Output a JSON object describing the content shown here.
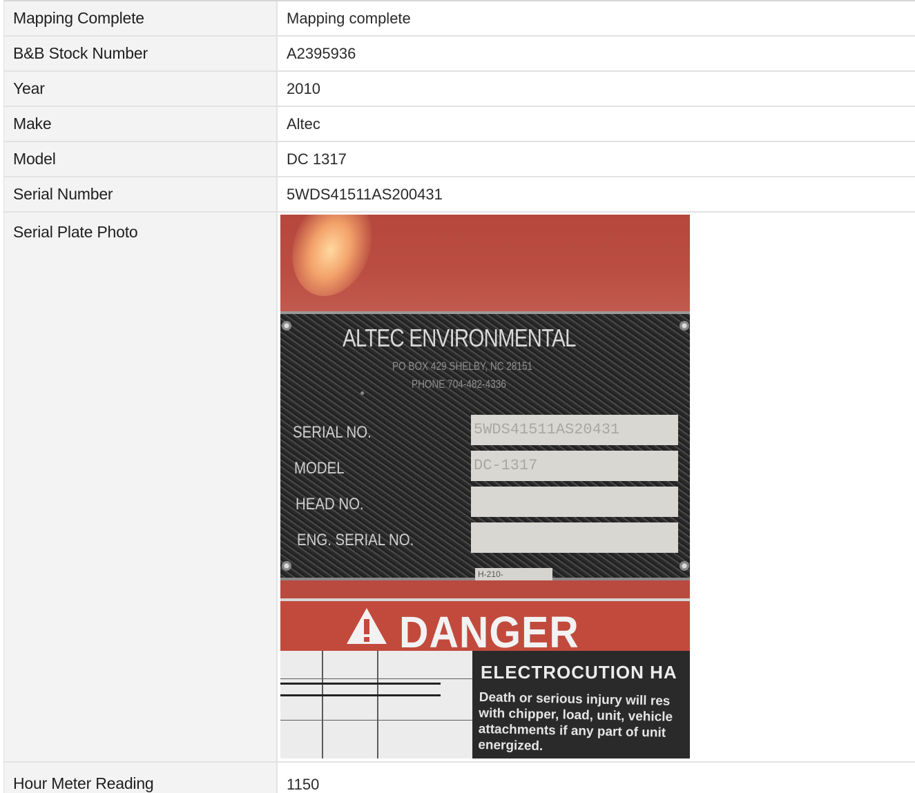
{
  "rows": [
    {
      "label": "Mapping Complete",
      "value": "Mapping complete"
    },
    {
      "label": "B&B Stock Number",
      "value": "A2395936"
    },
    {
      "label": "Year",
      "value": "2010"
    },
    {
      "label": "Make",
      "value": "Altec"
    },
    {
      "label": "Model",
      "value": "DC 1317"
    },
    {
      "label": "Serial Number",
      "value": "5WDS41511AS200431"
    },
    {
      "label": "Serial Plate Photo"
    },
    {
      "label": "Hour Meter Reading",
      "value": "1150"
    }
  ],
  "photo": {
    "plate_title": "ALTEC ENVIRONMENTAL",
    "plate_address": "PO BOX 429 SHELBY, NC 28151",
    "plate_phone": "PHONE  704-482-4336",
    "field_serial": "SERIAL NO.",
    "field_model": "MODEL",
    "field_head": "HEAD NO.",
    "field_eng_serial": "ENG. SERIAL NO.",
    "serial_box": "5WDS41511AS20431",
    "model_box": "DC-1317",
    "tag": "H-210-",
    "danger": "DANGER",
    "hazard_heading": "ELECTROCUTION HA",
    "hazard_body": "Death or serious injury will res\nwith chipper, load, unit, vehicle\nattachments if any part of unit\nenergized."
  },
  "colors": {
    "label_bg": "#f3f3f3",
    "border": "#e2e2e2",
    "danger_red": "#c24a3d"
  }
}
